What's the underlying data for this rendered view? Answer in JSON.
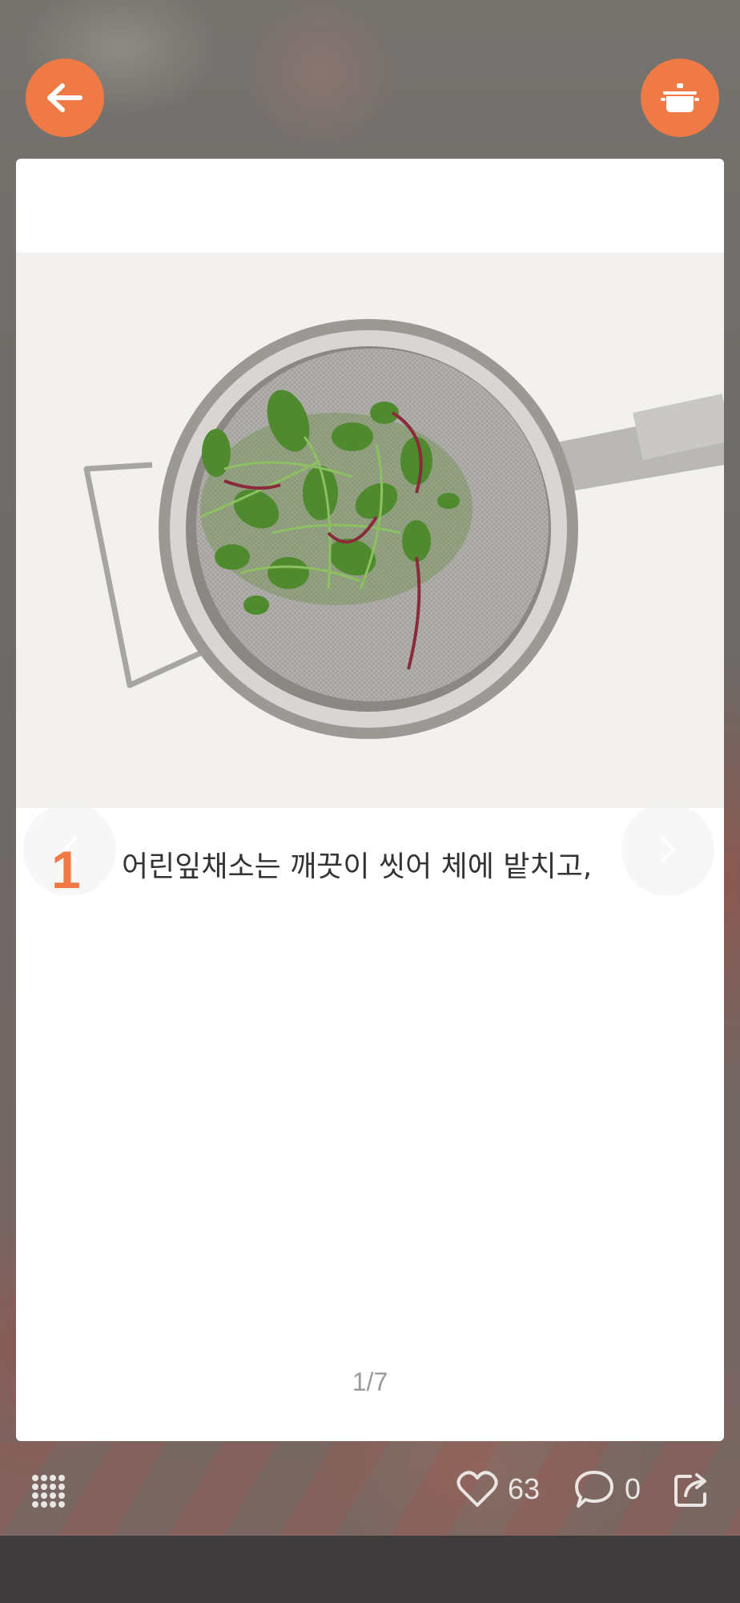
{
  "header": {
    "back_icon": "arrow-left-icon",
    "recipe_icon": "pot-icon",
    "accent_color": "#ef7a45"
  },
  "step": {
    "number": "1",
    "text": "어린잎채소는 깨끗이 씻어 체에 밭치고,",
    "image_icon": "strainer-with-greens-photo"
  },
  "pager": {
    "label": "1/7"
  },
  "footer": {
    "menu_icon": "grid-dots-icon",
    "like_icon": "heart-icon",
    "likes": "63",
    "comment_icon": "comment-bubble-icon",
    "comments": "0",
    "share_icon": "share-icon"
  }
}
